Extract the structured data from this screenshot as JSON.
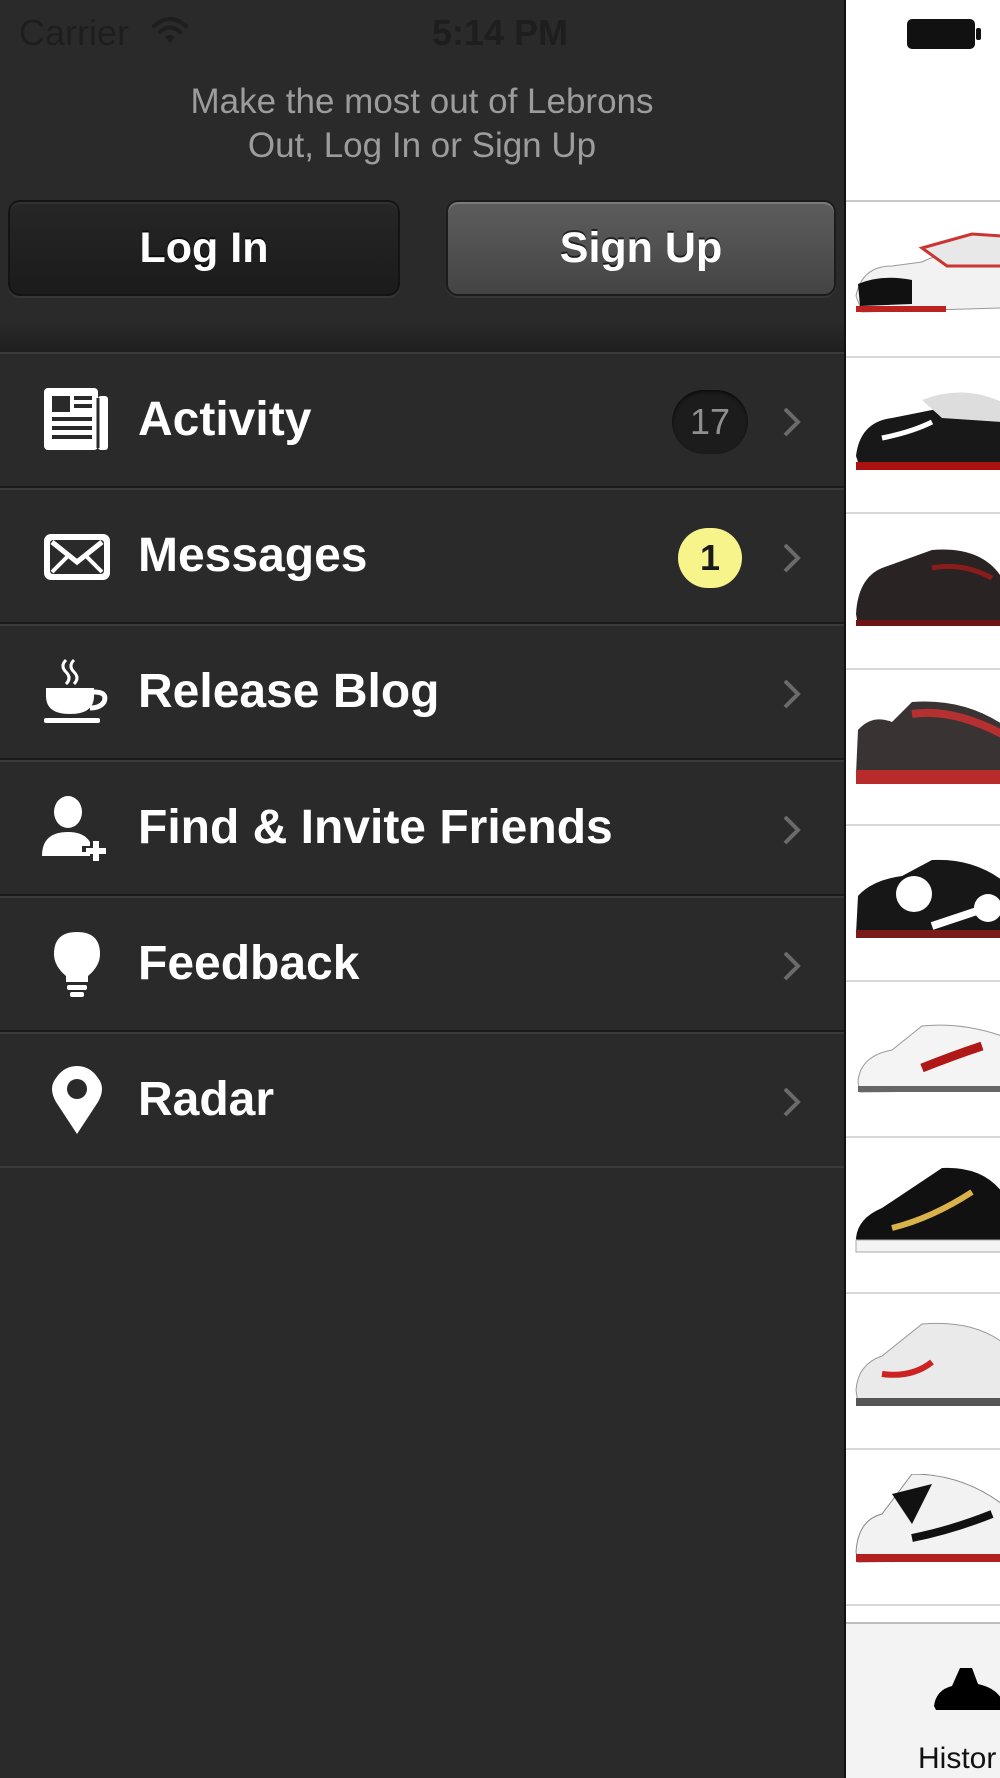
{
  "status_bar": {
    "carrier": "Carrier",
    "time": "5:14 PM"
  },
  "header": {
    "prompt_line1": "Make the most out of Lebrons",
    "prompt_line2": "Out, Log In or Sign Up",
    "login_label": "Log In",
    "signup_label": "Sign Up"
  },
  "menu": {
    "items": [
      {
        "label": "Activity",
        "icon": "newspaper-icon",
        "badge": "17"
      },
      {
        "label": "Messages",
        "icon": "envelope-icon",
        "badge": "1"
      },
      {
        "label": "Release Blog",
        "icon": "coffee-cup-icon"
      },
      {
        "label": "Find & Invite Friends",
        "icon": "add-person-icon"
      },
      {
        "label": "Feedback",
        "icon": "lightbulb-icon"
      },
      {
        "label": "Radar",
        "icon": "map-pin-icon"
      }
    ]
  },
  "peek_panel": {
    "tab_label": "Histor",
    "thumbnail_count_visible": 9
  },
  "colors": {
    "drawer_bg": "#2a2a2b",
    "text_primary": "#ffffff",
    "prompt_text": "#9c9c9c",
    "badge_yellow": "#f6f48a",
    "badge_dark": "#1c1c1d"
  }
}
